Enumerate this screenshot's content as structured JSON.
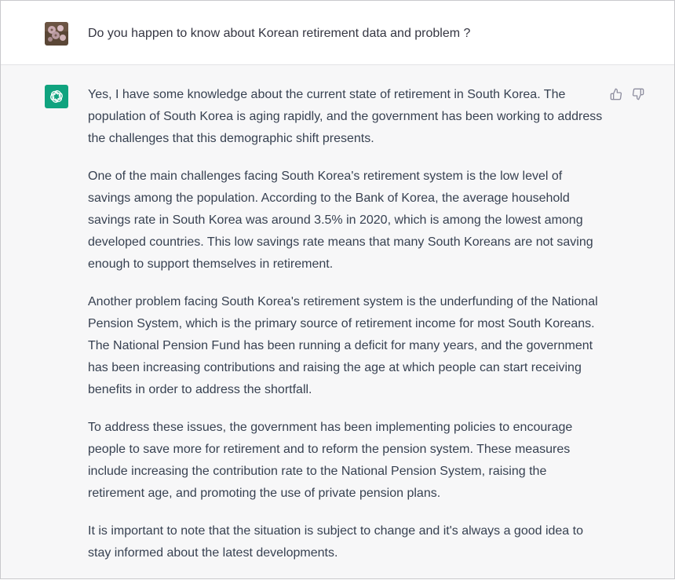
{
  "user_message": {
    "text": "Do you happen to know about Korean retirement data and problem ?"
  },
  "assistant_message": {
    "paragraphs": [
      "Yes, I have some knowledge about the current state of retirement in South Korea. The population of South Korea is aging rapidly, and the government has been working to address the challenges that this demographic shift presents.",
      "One of the main challenges facing South Korea's retirement system is the low level of savings among the population. According to the Bank of Korea, the average household savings rate in South Korea was around 3.5% in 2020, which is among the lowest among developed countries. This low savings rate means that many South Koreans are not saving enough to support themselves in retirement.",
      "Another problem facing South Korea's retirement system is the underfunding of the National Pension System, which is the primary source of retirement income for most South Koreans. The National Pension Fund has been running a deficit for many years, and the government has been increasing contributions and raising the age at which people can start receiving benefits in order to address the shortfall.",
      "To address these issues, the government has been implementing policies to encourage people to save more for retirement and to reform the pension system. These measures include increasing the contribution rate to the National Pension System, raising the retirement age, and promoting the use of private pension plans.",
      "It is important to note that the situation is subject to change and it's always a good idea to stay informed about the latest developments."
    ]
  },
  "icons": {
    "user_avatar": "user-avatar-photo",
    "assistant_avatar": "openai-logo-icon",
    "thumbs_up": "thumbs-up-icon",
    "thumbs_down": "thumbs-down-icon"
  },
  "colors": {
    "assistant_avatar_bg": "#10a37f",
    "assistant_row_bg": "#f7f7f8",
    "text": "#374151"
  }
}
